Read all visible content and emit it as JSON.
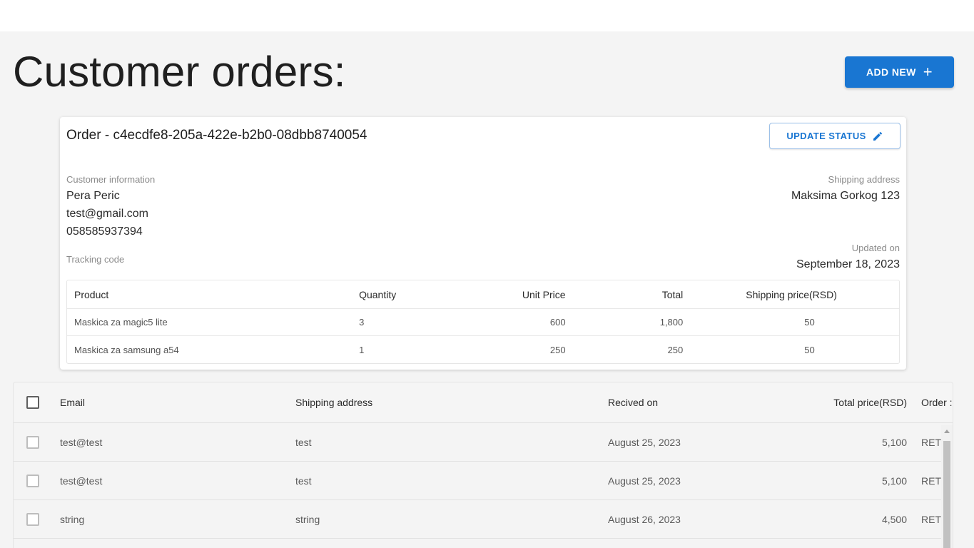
{
  "page": {
    "title": "Customer orders:",
    "add_new_label": "ADD NEW"
  },
  "order": {
    "title": "Order - c4ecdfe8-205a-422e-b2b0-08dbb8740054",
    "update_status_label": "UPDATE STATUS",
    "customer_info_label": "Customer information",
    "customer_name": "Pera Peric",
    "customer_email": "test@gmail.com",
    "customer_phone": "058585937394",
    "tracking_code_label": "Tracking code",
    "shipping_address_label": "Shipping address",
    "shipping_address": "Maksima Gorkog 123",
    "updated_on_label": "Updated on",
    "updated_on": "September 18, 2023",
    "items_headers": [
      "Product",
      "Quantity",
      "Unit Price",
      "Total",
      "Shipping price(RSD)"
    ],
    "items": [
      {
        "product": "Maskica za magic5 lite",
        "quantity": "3",
        "unit_price": "600",
        "total": "1,800",
        "shipping": "50"
      },
      {
        "product": "Maskica za samsung a54",
        "quantity": "1",
        "unit_price": "250",
        "total": "250",
        "shipping": "50"
      }
    ]
  },
  "grid": {
    "headers": {
      "email": "Email",
      "shipping_address": "Shipping address",
      "received_on": "Recived on",
      "total_price": "Total price(RSD)",
      "order_status": "Order :"
    },
    "rows": [
      {
        "email": "test@test",
        "shipping_address": "test",
        "received_on": "August 25, 2023",
        "total_price": "5,100",
        "status": "RET"
      },
      {
        "email": "test@test",
        "shipping_address": "test",
        "received_on": "August 25, 2023",
        "total_price": "5,100",
        "status": "RET"
      },
      {
        "email": "string",
        "shipping_address": "string",
        "received_on": "August 26, 2023",
        "total_price": "4,500",
        "status": "RET"
      }
    ]
  },
  "colors": {
    "accent": "#1976d2",
    "background": "#f4f4f4"
  }
}
